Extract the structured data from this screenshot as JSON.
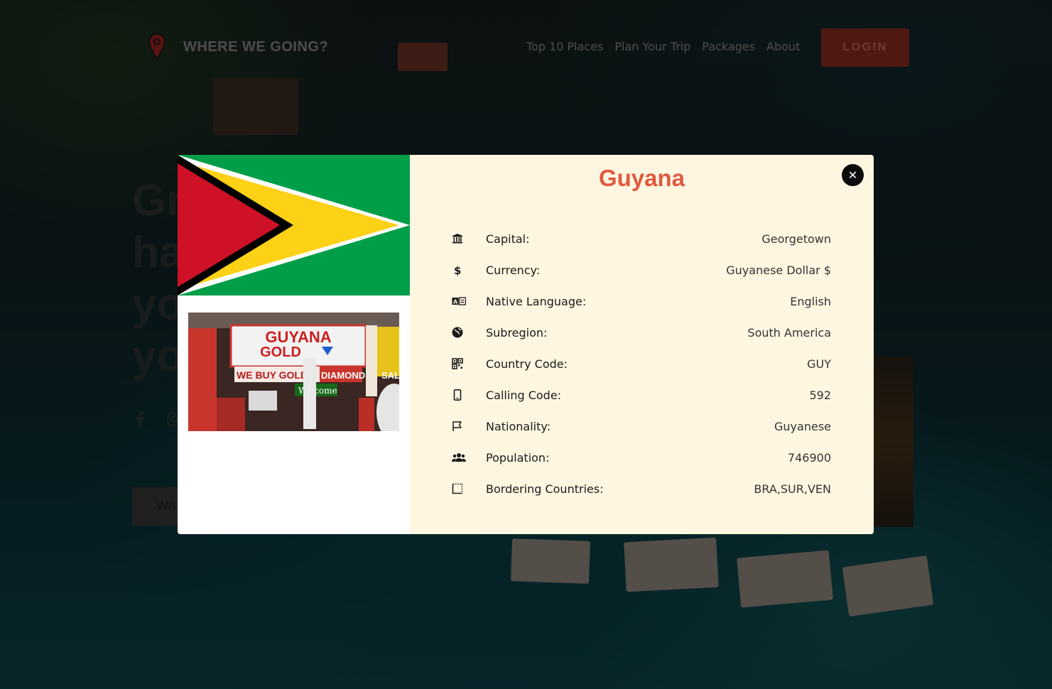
{
  "header": {
    "brand": "WHERE WE GOING?",
    "nav": [
      "Top 10 Places",
      "Plan Your Trip",
      "Packages",
      "About"
    ],
    "login_label": "LOGIN"
  },
  "hero": {
    "title_lines": [
      "Gr",
      "ha",
      "yo",
      "yo"
    ],
    "input_partial": "Wh"
  },
  "modal": {
    "country": "Guyana",
    "close_glyph": "✕",
    "rows": [
      {
        "icon": "bank-icon",
        "label": "Capital:",
        "value": "Georgetown"
      },
      {
        "icon": "dollar-icon",
        "label": "Currency:",
        "value": "Guyanese Dollar  $"
      },
      {
        "icon": "language-icon",
        "label": "Native Language:",
        "value": "English"
      },
      {
        "icon": "globe-icon",
        "label": "Subregion:",
        "value": "South America"
      },
      {
        "icon": "qr-code-icon",
        "label": "Country Code:",
        "value": "GUY"
      },
      {
        "icon": "phone-icon",
        "label": "Calling Code:",
        "value": "592"
      },
      {
        "icon": "flag-icon",
        "label": "Nationality:",
        "value": "Guyanese"
      },
      {
        "icon": "users-icon",
        "label": "Population:",
        "value": "746900"
      },
      {
        "icon": "border-icon",
        "label": "Bordering Countries:",
        "value": "BRA,SUR,VEN"
      }
    ],
    "photo_sign_text": [
      "GUYANA",
      "GOLD",
      "WE BUY GOLD",
      "DIAMOND",
      "SAL",
      "Welcome"
    ]
  },
  "colors": {
    "accent": "#e05a3f",
    "modal_panel": "#fef6e1",
    "login_button": "#4f1912"
  }
}
